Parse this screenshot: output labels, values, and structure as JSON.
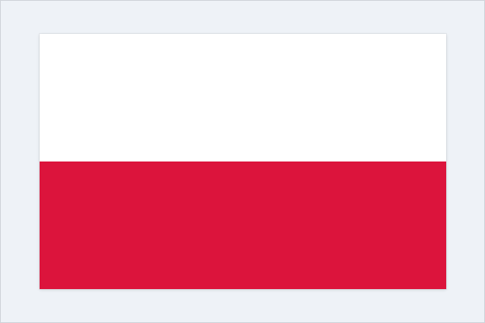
{
  "colors": {
    "background": "#eef2f7",
    "flag_top": "#ffffff",
    "flag_bottom": "#dc143c"
  },
  "flag": {
    "stripes": [
      {
        "color": "#ffffff"
      },
      {
        "color": "#dc143c"
      }
    ]
  }
}
